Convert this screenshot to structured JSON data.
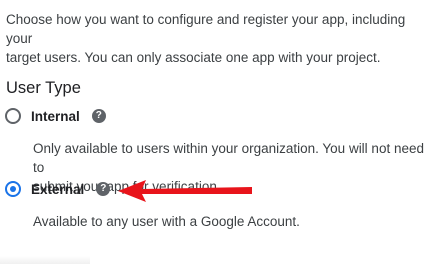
{
  "intro": {
    "line1": "Choose how you want to configure and register your app, including your",
    "line2": "target users. You can only associate one app with your project."
  },
  "user_type": {
    "title": "User Type",
    "options": [
      {
        "label": "Internal",
        "selected": false,
        "help_icon": "help-circle-icon",
        "description_line1": "Only available to users within your organization. You will not need to",
        "description_line2": "submit your app for verification."
      },
      {
        "label": "External",
        "selected": true,
        "help_icon": "help-circle-icon",
        "description_line1": "Available to any user with a Google Account."
      }
    ]
  },
  "annotation": {
    "arrow_color": "#e8141b",
    "arrow_target": "External"
  },
  "colors": {
    "accent": "#1a73e8",
    "text_primary": "#202124",
    "text_secondary": "#3c4043",
    "icon_gray": "#5f6368"
  }
}
